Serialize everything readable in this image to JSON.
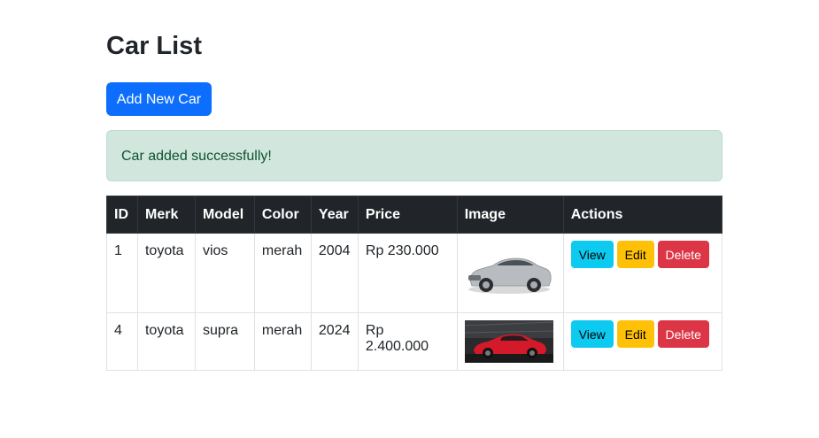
{
  "page": {
    "title": "Car List",
    "add_button_label": "Add New Car",
    "alert_message": "Car added successfully!"
  },
  "table": {
    "headers": [
      "ID",
      "Merk",
      "Model",
      "Color",
      "Year",
      "Price",
      "Image",
      "Actions"
    ],
    "rows": [
      {
        "id": "1",
        "merk": "toyota",
        "model": "vios",
        "color": "merah",
        "year": "2004",
        "price": "Rp 230.000",
        "image": "silver-sedan-photo"
      },
      {
        "id": "4",
        "merk": "toyota",
        "model": "supra",
        "color": "merah",
        "year": "2024",
        "price": "Rp 2.400.000",
        "image": "red-sports-car-photo"
      }
    ],
    "action_labels": {
      "view": "View",
      "edit": "Edit",
      "delete": "Delete"
    }
  },
  "colors": {
    "primary": "#0d6efd",
    "info": "#0dcaf0",
    "warning": "#ffc107",
    "danger": "#dc3545",
    "success_bg": "#d1e7dd",
    "header_bg": "#212529"
  }
}
